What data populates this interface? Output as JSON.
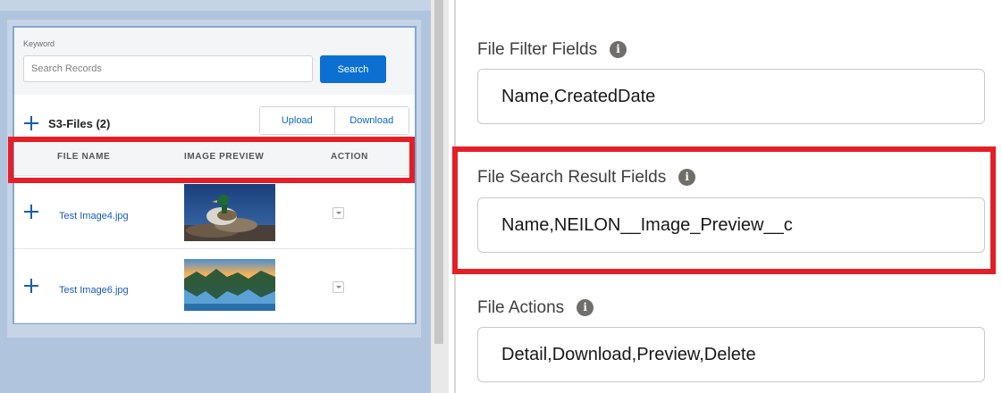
{
  "search": {
    "label": "Keyword",
    "placeholder": "Search Records",
    "button": "Search"
  },
  "files": {
    "title": "S3-Files (2)",
    "upload": "Upload",
    "download": "Download"
  },
  "table": {
    "headers": [
      "FILE NAME",
      "IMAGE PREVIEW",
      "ACTION"
    ],
    "rows": [
      {
        "name": "Test Image4.jpg",
        "preview": "duck photo"
      },
      {
        "name": "Test Image6.jpg",
        "preview": "lake landscape photo"
      }
    ]
  },
  "settings": {
    "filter_fields": {
      "label": "File Filter Fields",
      "value": "Name,CreatedDate"
    },
    "result_fields": {
      "label": "File Search Result Fields",
      "value": "Name,NEILON__Image_Preview__c"
    },
    "actions": {
      "label": "File Actions",
      "value": "Detail,Download,Preview,Delete"
    },
    "info_glyph": "i"
  },
  "colors": {
    "highlight": "#e51f26",
    "primary": "#0b70d2",
    "link": "#1b5bb5"
  }
}
